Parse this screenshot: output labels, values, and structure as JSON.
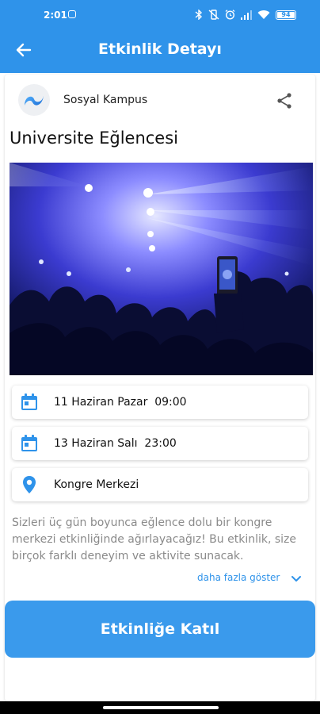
{
  "status_bar": {
    "time": "2:01",
    "battery": "94"
  },
  "app_bar": {
    "title": "Etkinlik Detayı",
    "back_icon": "arrow-back-icon"
  },
  "organizer": {
    "name": "Sosyal Kampus",
    "logo_icon": "wave-logo-icon"
  },
  "event": {
    "title": "Universite Eğlencesi",
    "image_alt": "concert-crowd-image",
    "start": "11 Haziran Pazar  09:00",
    "end": "13 Haziran Salı  23:00",
    "location": "Kongre Merkezi",
    "description": "Sizleri üç gün boyunca eğlence dolu bir kongre merkezi etkinliğinde ağırlayacağız! Bu etkinlik, size birçok farklı deneyim ve aktivite sunacak.",
    "more_label": "daha fazla göster"
  },
  "actions": {
    "join_label": "Etkinliğe Katıl"
  },
  "colors": {
    "primary": "#2f93ea",
    "button": "#3a9aec",
    "text_muted": "#8a8a8a"
  }
}
